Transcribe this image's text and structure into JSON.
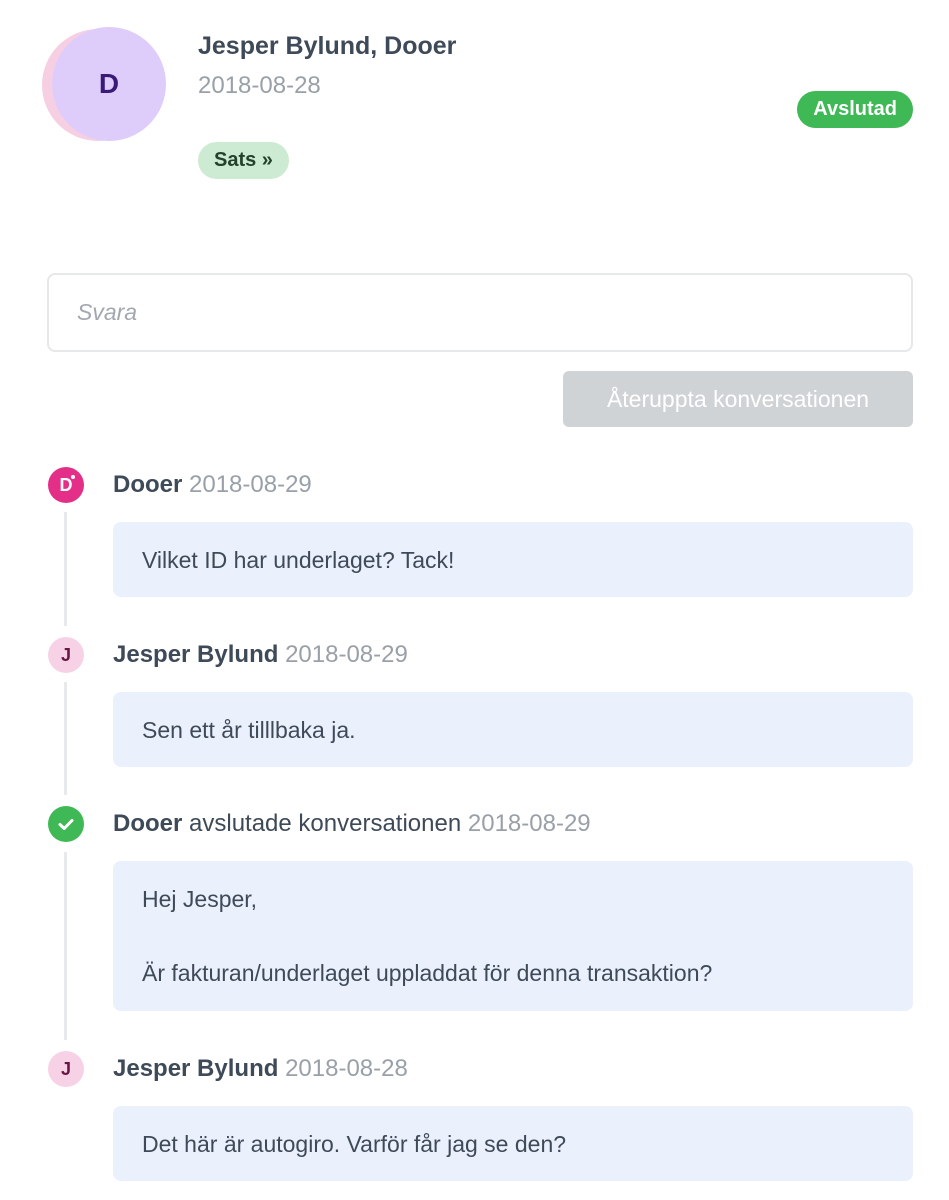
{
  "header": {
    "avatar_letter": "D",
    "title": "Jesper Bylund, Dooer",
    "date": "2018-08-28",
    "tag_label": "Sats »",
    "status_label": "Avslutad"
  },
  "reply": {
    "placeholder": "Svara"
  },
  "reopen_button_label": "Återuppta konversationen",
  "timeline": [
    {
      "author": "Dooer",
      "action": "",
      "date": "2018-08-29",
      "icon": "dooer-avatar-icon",
      "avatar_letter": "D",
      "message": [
        "Vilket ID har underlaget? Tack!"
      ]
    },
    {
      "author": "Jesper Bylund",
      "action": "",
      "date": "2018-08-29",
      "icon": "jesper-avatar-icon",
      "avatar_letter": "J",
      "message": [
        "Sen ett år tilllbaka ja."
      ]
    },
    {
      "author": "Dooer",
      "action": "avslutade konversationen",
      "date": "2018-08-29",
      "icon": "check-circle-icon",
      "message": [
        "Hej Jesper,",
        "Är fakturan/underlaget uppladdat för denna transaktion?"
      ]
    },
    {
      "author": "Jesper Bylund",
      "action": "",
      "date": "2018-08-28",
      "icon": "jesper-avatar-icon",
      "avatar_letter": "J",
      "message": [
        "Det här är autogiro. Varför får jag se den?"
      ]
    }
  ],
  "colors": {
    "status_green": "#3fb856",
    "tag_green_bg": "#cdebd3",
    "dooer_pink": "#e32f88",
    "avatar_lavender": "#decdfa",
    "bubble_bg": "#ebf0fd",
    "button_disabled": "#d0d3d6"
  }
}
